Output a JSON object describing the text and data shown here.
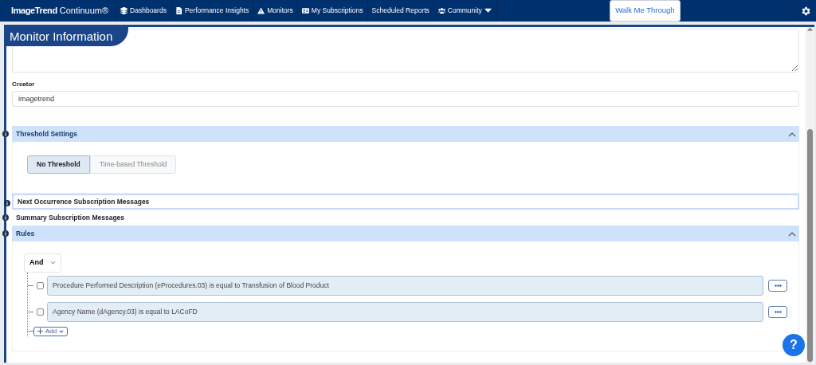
{
  "navbar": {
    "brand_strong": "ImageTrend",
    "brand_light": "Continuum®",
    "items": [
      {
        "label": "Dashboards",
        "dropdown": false
      },
      {
        "label": "Performance Insights",
        "dropdown": false
      },
      {
        "label": "Monitors",
        "dropdown": false
      },
      {
        "label": "My Subscriptions",
        "dropdown": false
      },
      {
        "label": "Scheduled Reports",
        "dropdown": false
      },
      {
        "label": "Community",
        "dropdown": true
      }
    ],
    "walkthrough": "Walk Me Through"
  },
  "page_title": "Monitor Information",
  "creator": {
    "label": "Creator",
    "value": "imagetrend"
  },
  "sections": [
    {
      "title": "Threshold Settings",
      "expanded": true,
      "focused": false,
      "kind": "threshold"
    },
    {
      "title": "Next Occurrence Subscription Messages",
      "expanded": false,
      "focused": true
    },
    {
      "title": "Summary Subscription Messages",
      "expanded": false,
      "focused": false
    },
    {
      "title": "Rules",
      "expanded": true,
      "focused": false,
      "kind": "rules"
    }
  ],
  "threshold_options": [
    {
      "label": "No Threshold",
      "selected": true
    },
    {
      "label": "Time-based Threshold",
      "selected": false
    }
  ],
  "rules": {
    "logic": "And",
    "conditions": [
      {
        "text": "Procedure Performed Description (eProcedures.03) is equal to Transfusion of Blood Product",
        "checked": false
      },
      {
        "text": "Agency Name (dAgency.03) is equal to LACoFD",
        "checked": false
      }
    ],
    "add_label": "Add"
  },
  "help_label": "?"
}
